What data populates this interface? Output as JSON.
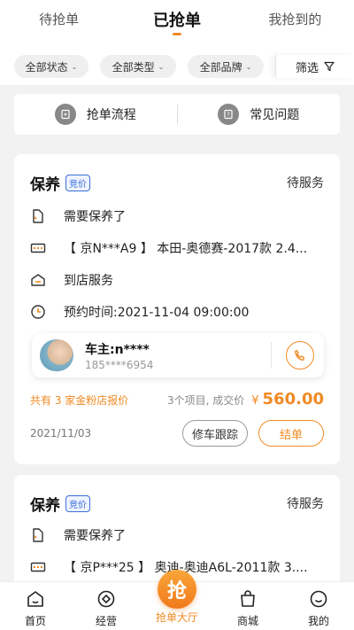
{
  "tabs": [
    {
      "label": "待抢单"
    },
    {
      "label": "已抢单"
    },
    {
      "label": "我抢到的"
    }
  ],
  "filters": {
    "status": "全部状态",
    "business_type": "全部类型",
    "brand": "全部品牌",
    "filter_label": "筛选"
  },
  "quick_links": {
    "process": "抢单流程",
    "faq": "常见问题"
  },
  "orders": [
    {
      "title": "保养",
      "badge": "竞价",
      "status": "待服务",
      "need": "需要保养了",
      "car": "【 京N***A9 】 本田-奥德赛-2017款 2.4...",
      "service": "到店服务",
      "appointment": "预约时间:2021-11-04 09:00:00",
      "owner_name": "车主:n****",
      "owner_phone": "185****6954",
      "quote_summary": "共有 3 家金粉店报价",
      "item_count": "3个项目, 成交价",
      "currency": "¥",
      "price": "560.00",
      "date": "2021/11/03",
      "track_button": "修车跟踪",
      "finish_button": "结单"
    },
    {
      "title": "保养",
      "badge": "竞价",
      "status": "待服务",
      "need": "需要保养了",
      "car": "【 京P***25 】 奥迪-奥迪A6L-2011款 3...."
    }
  ],
  "bottom_nav": [
    {
      "label": "首页",
      "icon": "home-icon"
    },
    {
      "label": "经营",
      "icon": "business-icon"
    },
    {
      "label": "抢单大厅",
      "icon": "grab-icon",
      "glyph": "抢"
    },
    {
      "label": "商城",
      "icon": "shop-icon"
    },
    {
      "label": "我的",
      "icon": "profile-icon"
    }
  ],
  "colors": {
    "accent": "#f08a24",
    "badge_blue": "#3a6fd8"
  }
}
